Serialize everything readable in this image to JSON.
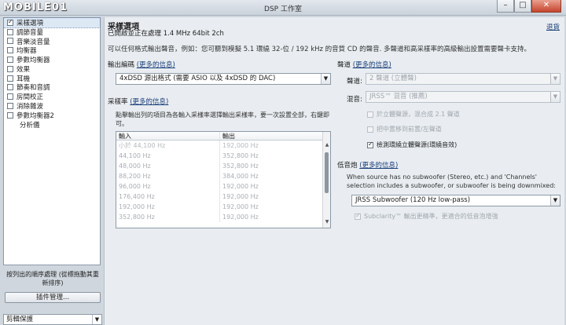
{
  "window": {
    "title": "DSP 工作室",
    "logo": "MOBILE01",
    "min": "–",
    "max": "□",
    "close": "✕"
  },
  "sidebar": {
    "items": [
      {
        "label": "采樣選項",
        "checked": true,
        "selected": true
      },
      {
        "label": "調節音量",
        "checked": false
      },
      {
        "label": "音樂淡音量",
        "checked": false
      },
      {
        "label": "均衡器",
        "checked": false
      },
      {
        "label": "參數均衡器",
        "checked": false
      },
      {
        "label": "效果",
        "checked": false
      },
      {
        "label": "耳機",
        "checked": false
      },
      {
        "label": "節奏和音調",
        "checked": false
      },
      {
        "label": "房間校正",
        "checked": false
      },
      {
        "label": "消除雜波",
        "checked": false
      },
      {
        "label": "參數均衡器2",
        "checked": false
      },
      {
        "label": "分析儀",
        "checkbox": false
      }
    ],
    "note": "按列出的順序處理 (從標拖動其重新排序)",
    "plugin_button": "插件管理...",
    "bottom_select": "剪輯保護"
  },
  "main": {
    "title": "采樣選項",
    "subtitle": "已開啟並正在處理 1.4 MHz 64bit 2ch",
    "hide_link": "退貨",
    "description": "可以任何格式輸出聲音，例如：您可聽到模擬 5.1 環繞 32-位 / 192 kHz 的音質 CD 的聲音. 多聲道和高采樣率的高級輸出設置需要聲卡支持。",
    "output_format": {
      "label": "輸出編碼",
      "more": "(更多的信息)",
      "value": "4xDSD 源出格式 (需要 ASIO 以及 4xDSD 的 DAC)"
    },
    "sample_rate": {
      "label": "采樣率",
      "more": "(更多的信息)",
      "description": "點擊輸出列的項目為各輸入采樣率選擇輸出采樣率，要一次設置全部，右鍵即可。",
      "col_in": "輸入",
      "col_out": "輸出",
      "rows": [
        {
          "in": "小於 44,100 Hz",
          "out": "192,000 Hz"
        },
        {
          "in": "44,100 Hz",
          "out": "352,800 Hz"
        },
        {
          "in": "48,000 Hz",
          "out": "352,800 Hz"
        },
        {
          "in": "88,200 Hz",
          "out": "384,000 Hz"
        },
        {
          "in": "96,000 Hz",
          "out": "192,000 Hz"
        },
        {
          "in": "176,400 Hz",
          "out": "192,000 Hz"
        },
        {
          "in": "192,000 Hz",
          "out": "192,000 Hz"
        },
        {
          "in": "352,800 Hz",
          "out": "192,000 Hz"
        }
      ]
    },
    "channels": {
      "label": "聲道",
      "more": "(更多的信息)",
      "channels_label": "聲道:",
      "channels_value": "2 聲道 (立體聲)",
      "mix_label": "混音:",
      "mix_value": "JRSS™ 混音 (推薦)",
      "opt1": "於立體聲源，混合成 2.1 聲道",
      "opt2": "把中置移到前置/左聲道",
      "opt3": "檢測環繞立體聲源(環繞音效)"
    },
    "bass": {
      "label": "低音炮",
      "more": "(更多的信息)",
      "description": "When source has no subwoofer (Stereo, etc.) and 'Channels' selection includes a subwoofer, or subwoofer is being downmixed:",
      "value": "JRSS Subwoofer (120 Hz low-pass)",
      "subclarity": "Subclarity™ 輸出更精準，更適合的低音泡增強"
    }
  }
}
